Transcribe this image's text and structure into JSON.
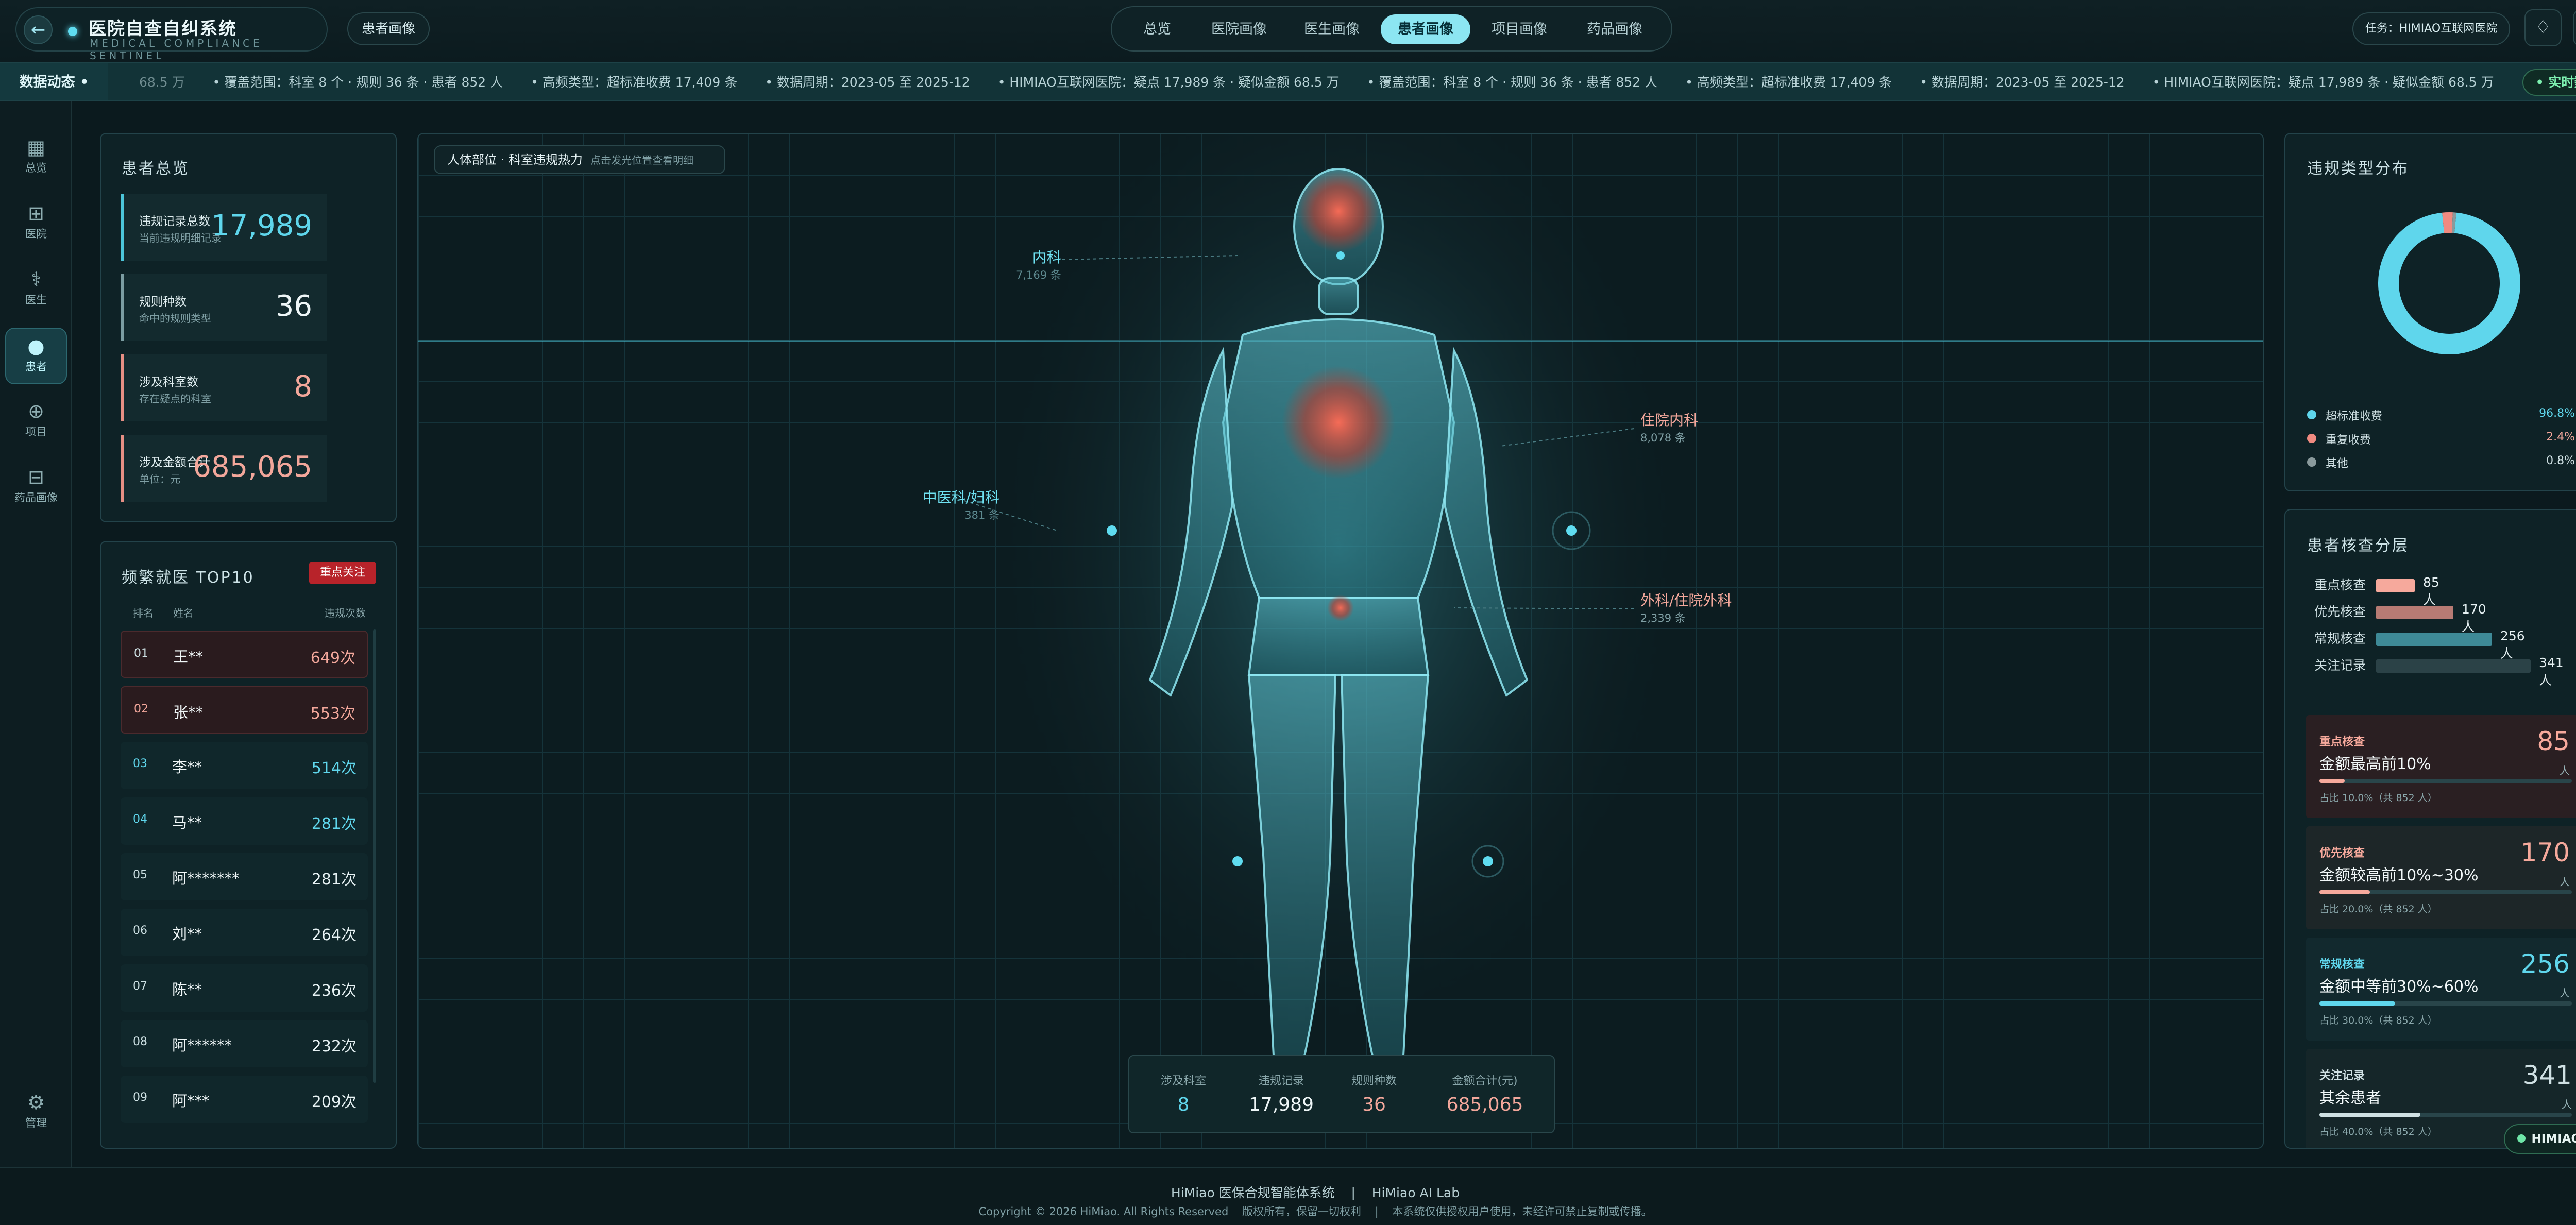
{
  "header": {
    "back_icon": "arrow-left-icon",
    "title": "医院自查自纠系统",
    "subtitle": "MEDICAL COMPLIANCE SENTINEL",
    "breadcrumb": "患者画像",
    "tabs": [
      {
        "label": "总览"
      },
      {
        "label": "医院画像"
      },
      {
        "label": "医生画像"
      },
      {
        "label": "患者画像",
        "active": true
      },
      {
        "label": "项目画像"
      },
      {
        "label": "药品画像"
      }
    ],
    "task": "任务：HIMIAO互联网医院",
    "bell_icon": "bell-icon",
    "settings_icon": "gear-icon"
  },
  "ticker": {
    "label": "数据动态 •",
    "items": [
      "68.5 万",
      "• 覆盖范围：科室 8 个 · 规则 36 条 · 患者 852 人",
      "• 高频类型：超标准收费 17,409 条",
      "• 数据周期：2023-05 至 2025-12",
      "• HIMIAO互联网医院：疑点 17,989 条 · 疑似金额 68.5 万",
      "• 覆盖范围：科室 8 个 · 规则 36 条 · 患者 852 人",
      "• 高频类型：超标准收费 17,409 条",
      "• 数据周期：2023-05 至 2025-12",
      "• HIMIAO互联网医院：疑点 17,989 条 · 疑似金额 68.5 万"
    ],
    "live": "• 实时数据"
  },
  "sidenav": [
    {
      "label": "总览",
      "icon": "grid-icon",
      "glyph": "▦"
    },
    {
      "label": "医院",
      "icon": "hospital-icon",
      "glyph": "⊞"
    },
    {
      "label": "医生",
      "icon": "stethoscope-icon",
      "glyph": "⚕"
    },
    {
      "label": "患者",
      "icon": "user-icon",
      "glyph": "●",
      "active": true
    },
    {
      "label": "项目",
      "icon": "medkit-icon",
      "glyph": "⊕"
    },
    {
      "label": "药品画像",
      "icon": "pill-icon",
      "glyph": "⊟"
    }
  ],
  "sidenav_bottom": {
    "label": "管理",
    "icon": "gear-icon",
    "glyph": "⚙"
  },
  "overview": {
    "title": "患者总览",
    "stats": [
      {
        "label": "违规记录总数",
        "sub": "当前违规明细记录",
        "value": "17,989",
        "color": "#5fd6ec"
      },
      {
        "label": "规则种数",
        "sub": "命中的规则类型",
        "value": "36",
        "color": "#eef6f7"
      },
      {
        "label": "涉及科室数",
        "sub": "存在疑点的科室",
        "value": "8",
        "color": "#f3a79b"
      },
      {
        "label": "涉及金额合计",
        "sub": "单位：元",
        "value": "685,065",
        "color": "#f3a79b"
      }
    ]
  },
  "top10": {
    "title": "频繁就医 TOP10",
    "tag": "重点关注",
    "col_rank": "排名",
    "col_name": "姓名",
    "col_count": "违规次数",
    "rows": [
      {
        "rank": "01",
        "name": "王**",
        "count": "649次"
      },
      {
        "rank": "02",
        "name": "张**",
        "count": "553次"
      },
      {
        "rank": "03",
        "name": "李**",
        "count": "514次"
      },
      {
        "rank": "04",
        "name": "马**",
        "count": "281次"
      },
      {
        "rank": "05",
        "name": "阿*******",
        "count": "281次"
      },
      {
        "rank": "06",
        "name": "刘**",
        "count": "264次"
      },
      {
        "rank": "07",
        "name": "陈**",
        "count": "236次"
      },
      {
        "rank": "08",
        "name": "阿******",
        "count": "232次"
      },
      {
        "rank": "09",
        "name": "阿***",
        "count": "209次"
      }
    ]
  },
  "body_map": {
    "title": "人体部位 · 科室违规热力",
    "hint": "点击发光位置查看明细",
    "labels": [
      {
        "dept": "内科",
        "count": "7,169 条"
      },
      {
        "dept": "住院内科",
        "count": "8,078 条"
      },
      {
        "dept": "中医科/妇科",
        "count": "381 条"
      },
      {
        "dept": "外科/住院外科",
        "count": "2,339 条"
      }
    ],
    "summary": [
      {
        "label": "涉及科室",
        "value": "8",
        "color": "#5fd6ec"
      },
      {
        "label": "违规记录",
        "value": "17,989",
        "color": "#eef6f7"
      },
      {
        "label": "规则种数",
        "value": "36",
        "color": "#f3a79b"
      },
      {
        "label": "金额合计(元)",
        "value": "685,065",
        "color": "#f3a79b"
      }
    ]
  },
  "violation_types": {
    "title": "违规类型分布",
    "chart_data": {
      "type": "pie",
      "categories": [
        "超标准收费",
        "重复收费",
        "其他"
      ],
      "values": [
        96.8,
        2.4,
        0.8
      ],
      "colors": [
        "#5fd6ec",
        "#f08a80",
        "#8a9a9c"
      ]
    },
    "legend": [
      {
        "name": "超标准收费",
        "pct": "96.8%",
        "color": "#5fd6ec"
      },
      {
        "name": "重复收费",
        "pct": "2.4%",
        "color": "#f08a80"
      },
      {
        "name": "其他",
        "pct": "0.8%",
        "color": "#8a9a9c"
      }
    ]
  },
  "tiers": {
    "title": "患者核查分层",
    "bars": [
      {
        "name": "重点核查",
        "count": "85人",
        "value": 85,
        "color": "#f6a99c"
      },
      {
        "name": "优先核查",
        "count": "170人",
        "value": 170,
        "color": "#b77b74"
      },
      {
        "name": "常规核查",
        "count": "256人",
        "value": 256,
        "color": "#3e8a97"
      },
      {
        "name": "关注记录",
        "count": "341人",
        "value": 341,
        "color": "#2b4247"
      }
    ],
    "cards": [
      {
        "kind": "重点核查",
        "title": "金额最高前10%",
        "num": "85",
        "unit": "人",
        "share": "占比 10.0%（共 852 人）",
        "fill": 0.1,
        "color": "#f6a99c",
        "bg": "#2a1f22"
      },
      {
        "kind": "优先核查",
        "title": "金额较高前10%~30%",
        "num": "170",
        "unit": "人",
        "share": "占比 20.0%（共 852 人）",
        "fill": 0.2,
        "color": "#f6a99c",
        "bg": "#1d2628"
      },
      {
        "kind": "常规核查",
        "title": "金额中等前30%~60%",
        "num": "256",
        "unit": "人",
        "share": "占比 30.0%（共 852 人）",
        "fill": 0.3,
        "color": "#5fd6ec",
        "bg": "#12292e"
      },
      {
        "kind": "关注记录",
        "title": "其余患者",
        "num": "341",
        "unit": "人",
        "share": "占比 40.0%（共 852 人）",
        "fill": 0.4,
        "color": "#cfe0e3",
        "bg": "#152629"
      }
    ]
  },
  "assistant": "HIMIAO AI",
  "footer": {
    "line1a": "HiMiao 医保合规智能体系统",
    "sep": "|",
    "line1b": "HiMiao AI Lab",
    "line2": "Copyright © 2026 HiMiao. All Rights Reserved    版权所有，保留一切权利    |    本系统仅供授权用户使用，未经许可禁止复制或传播。"
  }
}
